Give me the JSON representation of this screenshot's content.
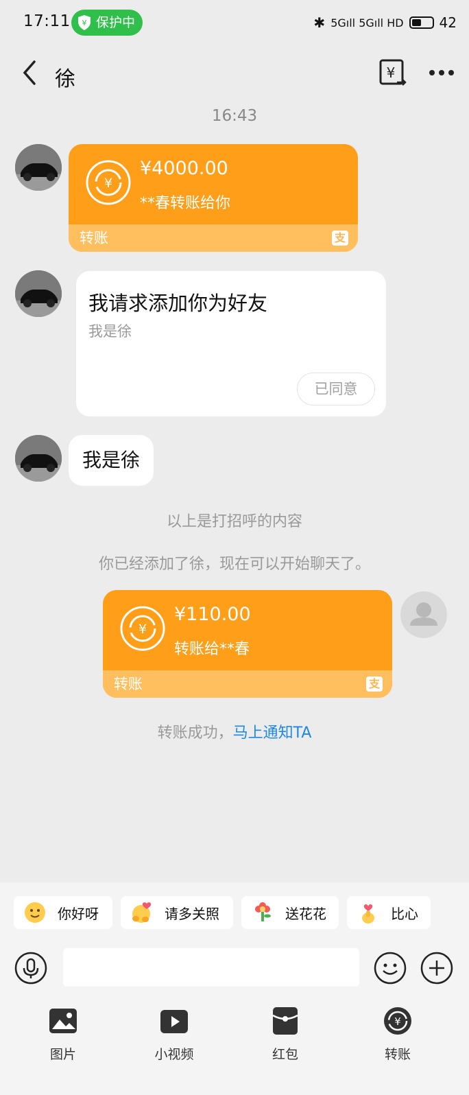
{
  "status_bar": {
    "time": "17:11",
    "protect_label": "保护中",
    "network": "5Gıll 5Gıll HD",
    "battery": "42"
  },
  "header": {
    "title": "徐"
  },
  "chat": {
    "timestamp": "16:43",
    "incoming_transfer": {
      "amount": "¥4000.00",
      "desc": "**春转账给你",
      "footer": "转账"
    },
    "friend_request": {
      "title": "我请求添加你为好友",
      "subtitle": "我是徐",
      "status": "已同意"
    },
    "greeting": "我是徐",
    "system_1": "以上是打招呼的内容",
    "system_2": "你已经添加了徐，现在可以开始聊天了。",
    "outgoing_transfer": {
      "amount": "¥110.00",
      "desc": "转账给**春",
      "footer": "转账"
    },
    "transfer_done": {
      "text": "转账成功，",
      "link": "马上通知TA"
    }
  },
  "quick_replies": [
    {
      "label": "你好呀",
      "icon": "smiling-face-icon"
    },
    {
      "label": "请多关照",
      "icon": "hugging-face-icon"
    },
    {
      "label": "送花花",
      "icon": "flower-icon"
    },
    {
      "label": "比心",
      "icon": "finger-heart-icon"
    }
  ],
  "toolbar": [
    {
      "label": "图片",
      "icon": "image-icon"
    },
    {
      "label": "小视频",
      "icon": "video-icon"
    },
    {
      "label": "红包",
      "icon": "red-packet-icon"
    },
    {
      "label": "转账",
      "icon": "transfer-icon"
    }
  ],
  "colors": {
    "transfer_orange": "#ff9e18",
    "transfer_footer": "#ffbf5e",
    "link_blue": "#1e88e5",
    "protect_green": "#2fbf4a"
  }
}
